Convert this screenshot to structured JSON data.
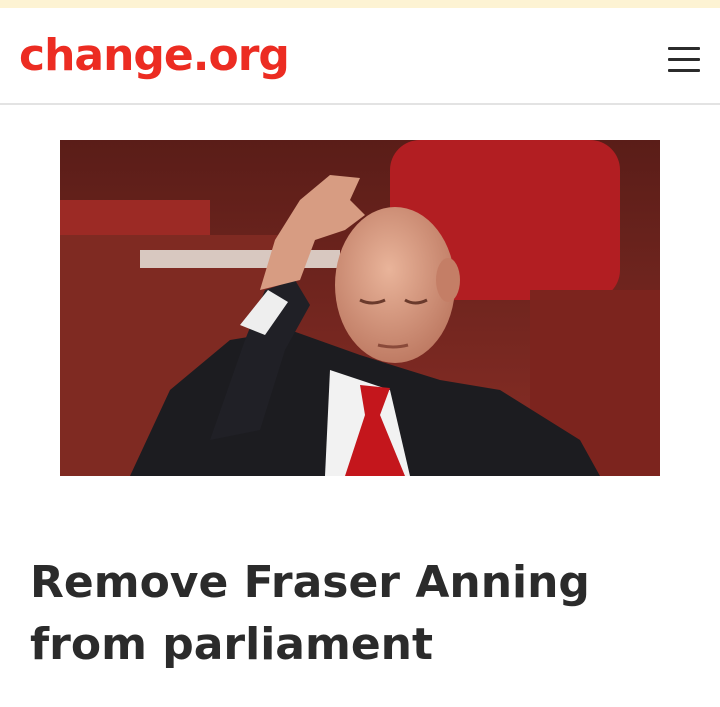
{
  "header": {
    "logo_text": "change.org",
    "brand_color": "#ec2c22",
    "menu_icon": "hamburger-menu-icon"
  },
  "hero": {
    "image_subject": "photo"
  },
  "petition": {
    "title": "Remove Fraser Anning from parliament"
  }
}
